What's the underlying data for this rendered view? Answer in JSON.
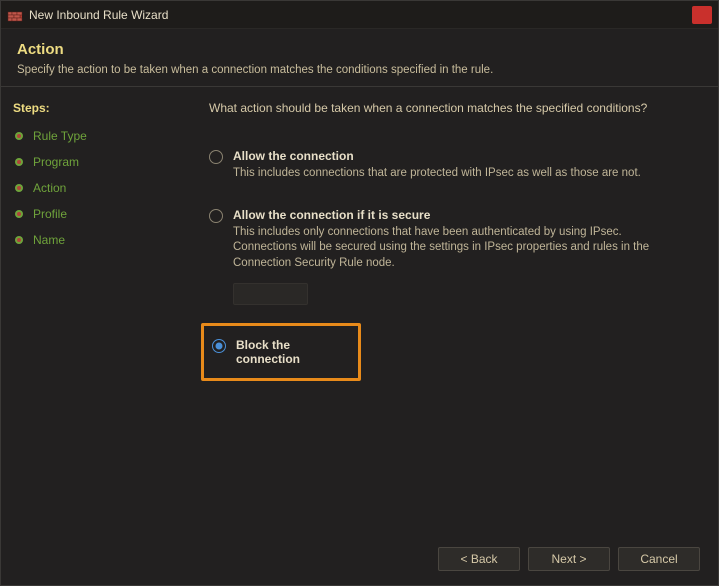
{
  "window": {
    "title": "New Inbound Rule Wizard"
  },
  "header": {
    "title": "Action",
    "subtitle": "Specify the action to be taken when a connection matches the conditions specified in the rule."
  },
  "steps": {
    "heading": "Steps:",
    "items": [
      {
        "label": "Rule Type"
      },
      {
        "label": "Program"
      },
      {
        "label": "Action"
      },
      {
        "label": "Profile"
      },
      {
        "label": "Name"
      }
    ]
  },
  "content": {
    "question": "What action should be taken when a connection matches the specified conditions?",
    "options": [
      {
        "label": "Allow the connection",
        "desc": "This includes connections that are protected with IPsec as well as those are not."
      },
      {
        "label": "Allow the connection if it is secure",
        "desc": "This includes only connections that have been authenticated by using IPsec.  Connections will be secured using the settings in IPsec properties and rules in the Connection Security Rule node."
      },
      {
        "label": "Block the connection"
      }
    ]
  },
  "footer": {
    "back": "< Back",
    "next": "Next >",
    "cancel": "Cancel"
  }
}
